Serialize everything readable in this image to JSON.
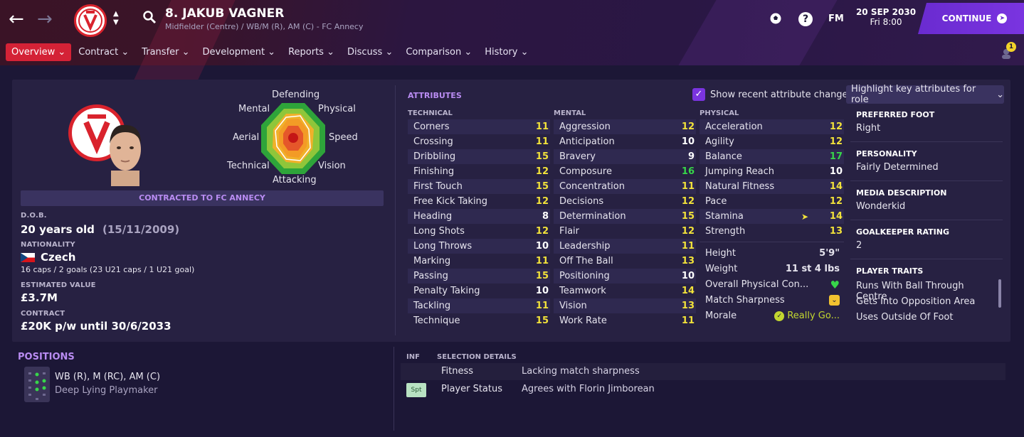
{
  "header": {
    "player_name": "8. JAKUB VAGNER",
    "subtitle": "Midfielder (Centre) / WB/M (R), AM (C) - FC Annecy",
    "fm_label": "FM",
    "date": "20 SEP 2030",
    "day_time": "Fri 8:00",
    "continue_label": "CONTINUE",
    "notification_count": "1"
  },
  "menu": [
    {
      "label": "Overview",
      "active": true
    },
    {
      "label": "Contract"
    },
    {
      "label": "Transfer"
    },
    {
      "label": "Development"
    },
    {
      "label": "Reports"
    },
    {
      "label": "Discuss"
    },
    {
      "label": "Comparison"
    },
    {
      "label": "History"
    }
  ],
  "profile": {
    "contract_banner": "CONTRACTED TO FC ANNECY",
    "dob_label": "D.O.B.",
    "dob_value": "20 years old",
    "dob_date": "(15/11/2009)",
    "nationality_label": "NATIONALITY",
    "nationality": "Czech",
    "caps": "16 caps / 2 goals (23 U21 caps / 1 U21 goal)",
    "value_label": "ESTIMATED VALUE",
    "value": "£3.7M",
    "contract_label": "CONTRACT",
    "contract": "£20K p/w until 30/6/2033"
  },
  "radar": {
    "labels": [
      "Defending",
      "Physical",
      "Speed",
      "Vision",
      "Attacking",
      "Technical",
      "Aerial",
      "Mental"
    ]
  },
  "attributes": {
    "title": "ATTRIBUTES",
    "show_changes_label": "Show recent attribute changes",
    "highlight_label": "Highlight key attributes for role",
    "technical_label": "TECHNICAL",
    "mental_label": "MENTAL",
    "physical_label": "PHYSICAL",
    "technical": [
      {
        "name": "Corners",
        "value": "11"
      },
      {
        "name": "Crossing",
        "value": "11"
      },
      {
        "name": "Dribbling",
        "value": "15"
      },
      {
        "name": "Finishing",
        "value": "12"
      },
      {
        "name": "First Touch",
        "value": "15"
      },
      {
        "name": "Free Kick Taking",
        "value": "12"
      },
      {
        "name": "Heading",
        "value": "8"
      },
      {
        "name": "Long Shots",
        "value": "12"
      },
      {
        "name": "Long Throws",
        "value": "10"
      },
      {
        "name": "Marking",
        "value": "11"
      },
      {
        "name": "Passing",
        "value": "15"
      },
      {
        "name": "Penalty Taking",
        "value": "10"
      },
      {
        "name": "Tackling",
        "value": "11"
      },
      {
        "name": "Technique",
        "value": "15"
      }
    ],
    "mental": [
      {
        "name": "Aggression",
        "value": "12"
      },
      {
        "name": "Anticipation",
        "value": "10"
      },
      {
        "name": "Bravery",
        "value": "9"
      },
      {
        "name": "Composure",
        "value": "16"
      },
      {
        "name": "Concentration",
        "value": "11"
      },
      {
        "name": "Decisions",
        "value": "12"
      },
      {
        "name": "Determination",
        "value": "15"
      },
      {
        "name": "Flair",
        "value": "12"
      },
      {
        "name": "Leadership",
        "value": "11"
      },
      {
        "name": "Off The Ball",
        "value": "13"
      },
      {
        "name": "Positioning",
        "value": "10"
      },
      {
        "name": "Teamwork",
        "value": "14"
      },
      {
        "name": "Vision",
        "value": "13"
      },
      {
        "name": "Work Rate",
        "value": "11"
      }
    ],
    "physical": [
      {
        "name": "Acceleration",
        "value": "12"
      },
      {
        "name": "Agility",
        "value": "12"
      },
      {
        "name": "Balance",
        "value": "17"
      },
      {
        "name": "Jumping Reach",
        "value": "10"
      },
      {
        "name": "Natural Fitness",
        "value": "14"
      },
      {
        "name": "Pace",
        "value": "12"
      },
      {
        "name": "Stamina",
        "value": "14"
      },
      {
        "name": "Strength",
        "value": "13"
      }
    ],
    "height_label": "Height",
    "height": "5'9\"",
    "weight_label": "Weight",
    "weight": "11 st 4 lbs",
    "condition_label": "Overall Physical Con...",
    "sharpness_label": "Match Sharpness",
    "morale_label": "Morale",
    "morale_value": "Really Go..."
  },
  "info": {
    "foot_label": "PREFERRED FOOT",
    "foot": "Right",
    "personality_label": "PERSONALITY",
    "personality": "Fairly Determined",
    "media_label": "MEDIA DESCRIPTION",
    "media": "Wonderkid",
    "gk_label": "GOALKEEPER RATING",
    "gk": "2",
    "traits_label": "PLAYER TRAITS",
    "traits": [
      "Runs With Ball Through Centre",
      "Gets Into Opposition Area",
      "Uses Outside Of Foot"
    ]
  },
  "positions": {
    "title": "POSITIONS",
    "list": "WB (R), M (RC), AM (C)",
    "role": "Deep Lying Playmaker"
  },
  "selection": {
    "inf_label": "INF",
    "details_label": "SELECTION DETAILS",
    "rows": [
      {
        "badge": "",
        "label": "Fitness",
        "value": "Lacking match sharpness"
      },
      {
        "badge": "Spt",
        "label": "Player Status",
        "value": "Agrees with Florin Jimborean"
      }
    ]
  },
  "colors": {
    "accent_red": "#d42236",
    "accent_purple": "#7a34e0",
    "attr_yellow": "#f2e23a",
    "attr_green": "#37d64a"
  }
}
